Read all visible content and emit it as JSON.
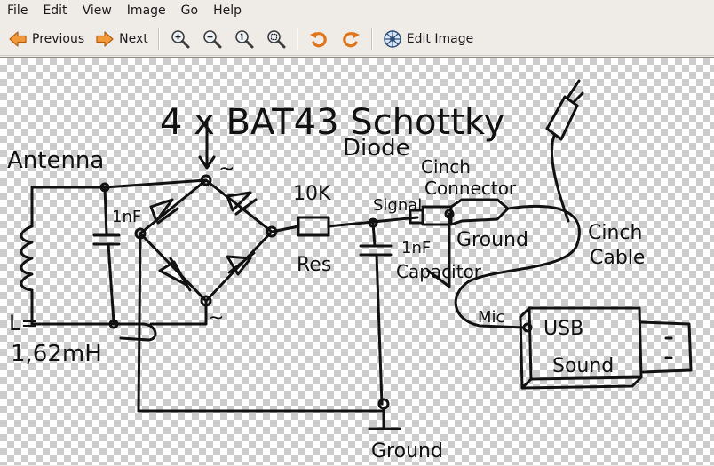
{
  "menubar": {
    "items": [
      "File",
      "Edit",
      "View",
      "Image",
      "Go",
      "Help"
    ]
  },
  "toolbar": {
    "previous_label": "Previous",
    "next_label": "Next",
    "edit_image_label": "Edit Image",
    "icons": [
      "arrow-left-icon",
      "arrow-right-icon",
      "zoom-in-icon",
      "zoom-out-icon",
      "zoom-normal-icon",
      "zoom-fit-icon",
      "rotate-left-icon",
      "rotate-right-icon",
      "edit-image-icon"
    ]
  },
  "image": {
    "labels": {
      "title": "4 x BAT43 Schottky",
      "title_line2": "Diode",
      "antenna": "Antenna",
      "cap_1nf_left": "1nF",
      "inductor_l": "L=",
      "inductor_value": "1,62mH",
      "resistor_value": "10K",
      "resistor_name": "Res",
      "signal": "Signal",
      "cinch_connector_1": "Cinch",
      "cinch_connector_2": "Connector",
      "ground_right": "Ground",
      "cap_1nf_right": "1nF",
      "capacitor": "Capacitor",
      "cinch_cable_1": "Cinch",
      "cinch_cable_2": "Cable",
      "mic": "Mic",
      "usb": "USB",
      "sound": "Sound",
      "ground_bottom": "Ground",
      "tilde_top": "~",
      "tilde_bottom": "~"
    },
    "colors": {
      "ink": "#111111",
      "checker_light": "#ffffff",
      "checker_dark": "#cccccc"
    }
  }
}
